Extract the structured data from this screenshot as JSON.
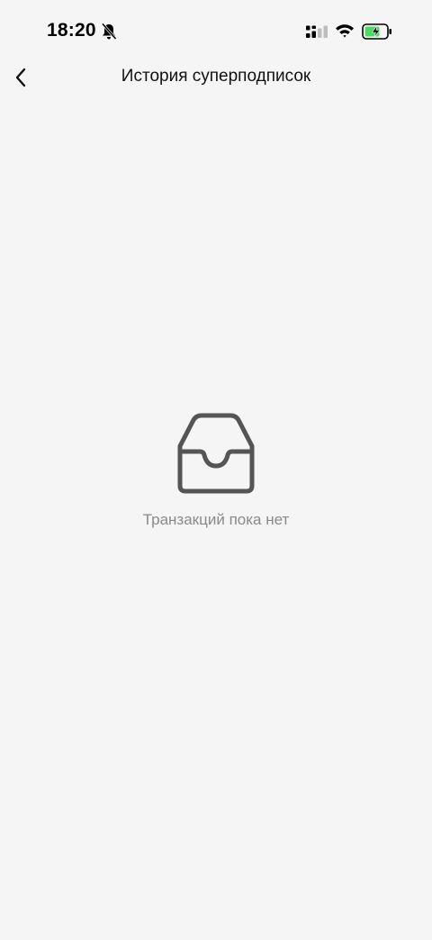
{
  "status_bar": {
    "time": "18:20",
    "icons": [
      "bell-muted-icon",
      "signal-icon",
      "wifi-icon",
      "battery-charging-icon"
    ],
    "battery_color": "#4cd964"
  },
  "header": {
    "back_icon": "chevron-left-icon",
    "title": "История суперподписок"
  },
  "empty_state": {
    "icon": "inbox-tray-icon",
    "message": "Транзакций пока нет"
  },
  "colors": {
    "background": "#f5f5f5",
    "title": "#111111",
    "empty_text": "#8a8a8a",
    "icon": "#555555"
  }
}
